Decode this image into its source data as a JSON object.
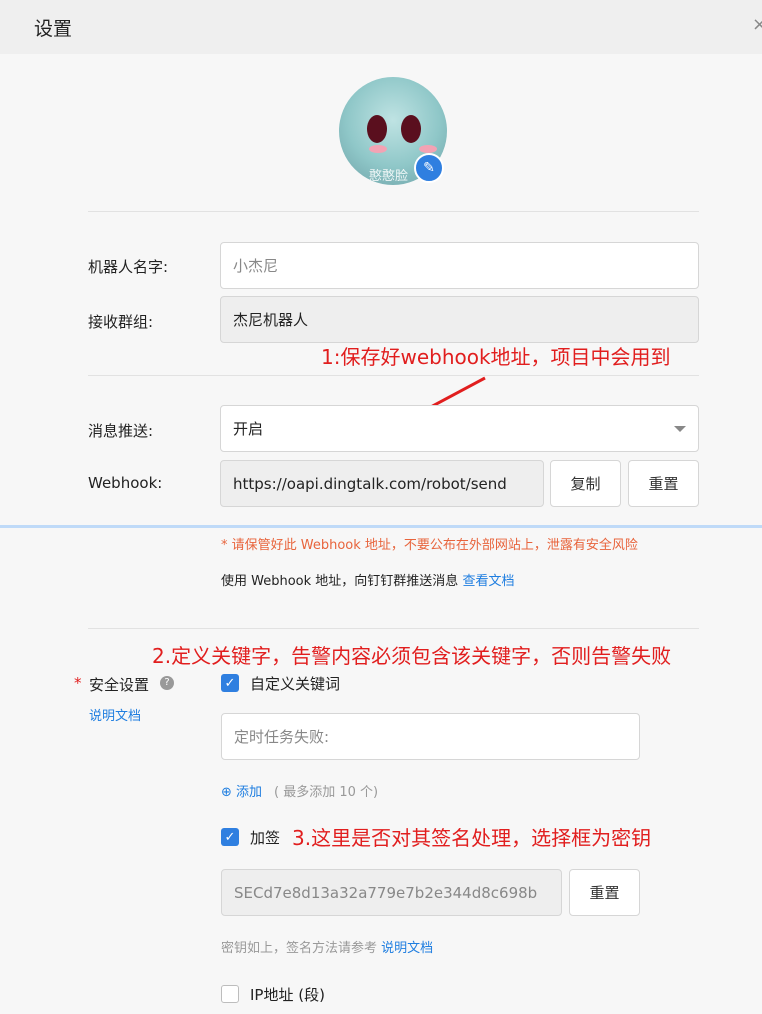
{
  "dialog": {
    "title": "设置",
    "close_icon": "close-icon"
  },
  "avatar": {
    "caption": "憨憨脸",
    "edit_icon": "pencil-icon"
  },
  "form": {
    "robot_name_label": "机器人名字:",
    "robot_name_value": "小杰尼",
    "group_label": "接收群组:",
    "group_value": "杰尼机器人",
    "push_label": "消息推送:",
    "push_value": "开启",
    "webhook_label": "Webhook:",
    "webhook_value": "https://oapi.dingtalk.com/robot/send",
    "copy_label": "复制",
    "reset_label": "重置",
    "warning": "* 请保管好此 Webhook 地址，不要公布在外部网站上，泄露有安全风险",
    "usage_text": "使用 Webhook 地址，向钉钉群推送消息",
    "usage_link": "查看文档",
    "security_required": "*",
    "security_label": "安全设置",
    "security_doc_link": "说明文档",
    "keyword_label": "自定义关键词",
    "keyword_value": "定时任务失败:",
    "add_label": "添加",
    "add_hint": "( 最多添加 10 个)",
    "sign_label": "加签",
    "secret_value": "SECd7e8d13a32a779e7b2e344d8c698b",
    "secret_reset_label": "重置",
    "secret_note": "密钥如上，签名方法请参考",
    "secret_note_link": "说明文档",
    "ip_label": "IP地址 (段)"
  },
  "annotations": {
    "a1": "1:保存好webhook地址，项目中会用到",
    "a2": "2.定义关键字，告警内容必须包含该关键字，否则告警失败",
    "a3": "3.这里是否对其签名处理，选择框为密钥"
  },
  "checkboxes": {
    "keyword_checked": true,
    "sign_checked": true,
    "ip_checked": false
  },
  "colors": {
    "primary": "#2f7fe0",
    "annotation": "#e11e1e",
    "warning": "#e8643c"
  }
}
